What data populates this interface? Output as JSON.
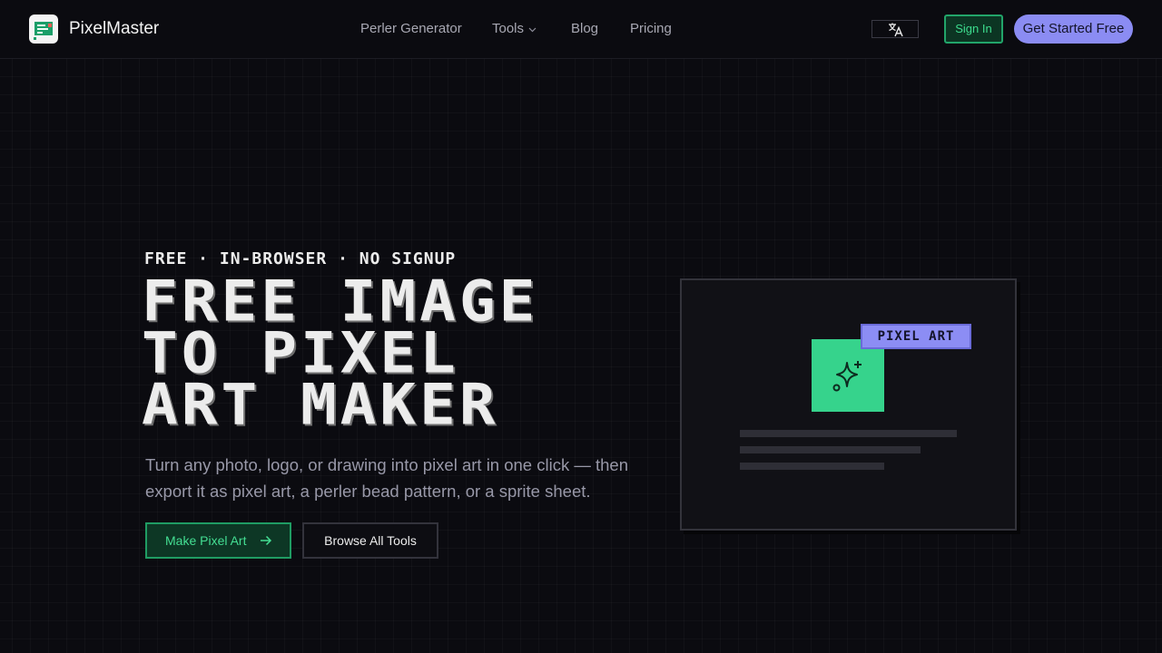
{
  "header": {
    "brand": "PixelMaster",
    "nav": [
      {
        "label": "Perler Generator"
      },
      {
        "label": "Tools"
      },
      {
        "label": "Blog"
      },
      {
        "label": "Pricing"
      }
    ],
    "sign_in": "Sign In",
    "cta": "Get Started Free"
  },
  "hero": {
    "kicker": "FREE · IN-BROWSER · NO SIGNUP",
    "headline": [
      "FREE IMAGE",
      "TO PIXEL",
      "ART MAKER"
    ],
    "subtitle": "Turn any photo, logo, or drawing into pixel art in one click — then export it as pixel art, a perler bead pattern, or a sprite sheet.",
    "primary_button": "Make Pixel Art",
    "secondary_button": "Browse All Tools"
  },
  "preview": {
    "badge": "PIXEL ART"
  },
  "icons": {
    "logo": "pixelmaster-logo-icon",
    "tools_chevron": "chevron-down-icon",
    "language": "translate-icon",
    "arrow": "arrow-right-icon",
    "sparkle": "sparkle-icon"
  },
  "colors": {
    "background": "#0b0b10",
    "accent_green": "#36d38c",
    "accent_purple": "#8b8cf3"
  }
}
